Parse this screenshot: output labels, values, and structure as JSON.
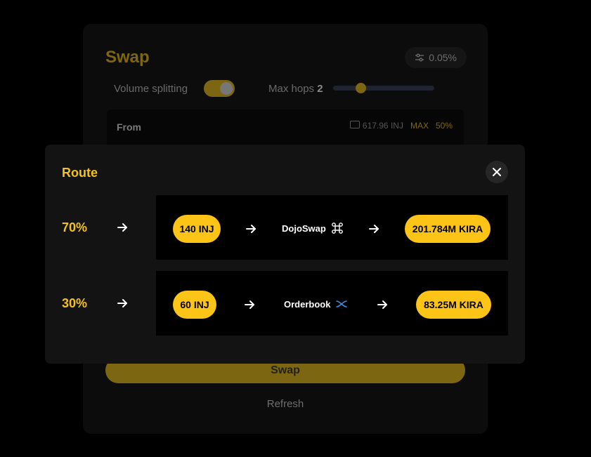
{
  "swap_card": {
    "title": "Swap",
    "slippage": "0.05%",
    "volume_splitting_label": "Volume splitting",
    "max_hops_label": "Max hops",
    "max_hops_value": "2",
    "from_label": "From",
    "balance": "617.96 INJ",
    "max_label": "MAX",
    "half_label": "50%",
    "swap_button": "Swap",
    "refresh_button": "Refresh"
  },
  "route_modal": {
    "title": "Route",
    "routes": [
      {
        "percent": "70%",
        "from_amount": "140 INJ",
        "dex": "DojoSwap",
        "to_amount": "201.784M KIRA"
      },
      {
        "percent": "30%",
        "from_amount": "60 INJ",
        "dex": "Orderbook",
        "to_amount": "83.25M KIRA"
      }
    ]
  },
  "colors": {
    "accent": "#fcc416",
    "accent_dim": "#7d6612",
    "modal_bg": "#131313",
    "route_bg": "#000000"
  }
}
